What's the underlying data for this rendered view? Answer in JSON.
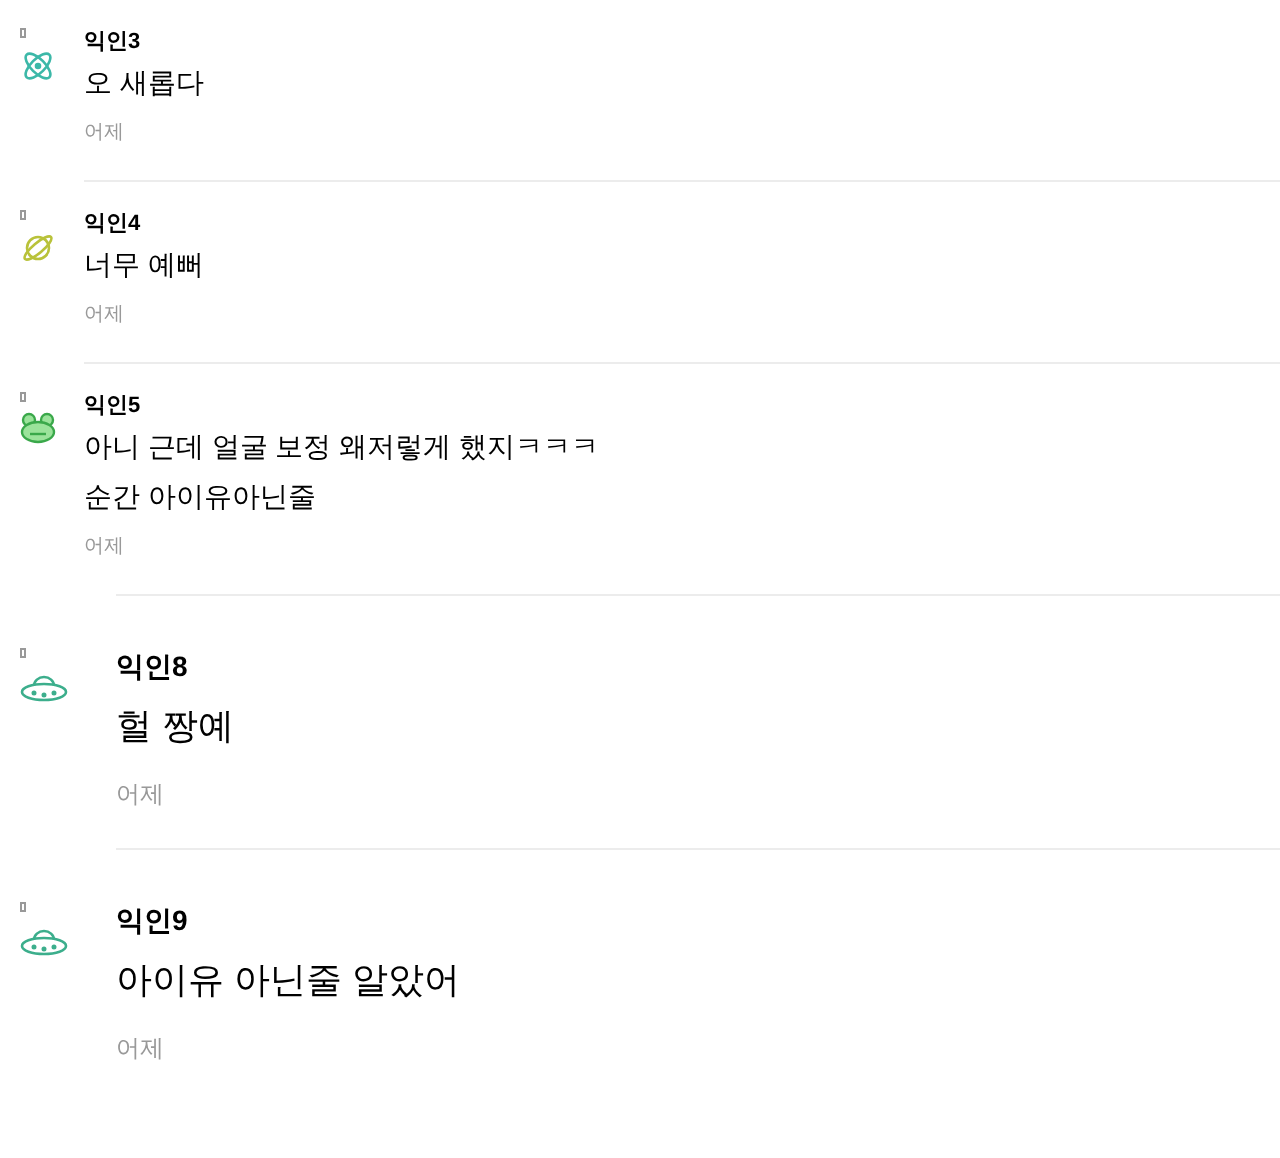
{
  "comments": [
    {
      "kind": "small",
      "avatar": {
        "kind": "atom"
      },
      "author": "익인3",
      "lines": [
        "오 새롭다"
      ],
      "time": "어제"
    },
    {
      "kind": "small",
      "avatar": {
        "kind": "planet"
      },
      "author": "익인4",
      "lines": [
        "너무 예뻐"
      ],
      "time": "어제"
    },
    {
      "kind": "small",
      "avatar": {
        "kind": "frog"
      },
      "author": "익인5",
      "lines": [
        "아니 근데 얼굴 보정 왜저렇게 했지ㅋㅋㅋ",
        "순간 아이유아닌줄"
      ],
      "time": "어제"
    },
    {
      "kind": "large",
      "avatar": {
        "kind": "ufo"
      },
      "author": "익인8",
      "lines": [
        "헐 짱예"
      ],
      "time": "어제"
    },
    {
      "kind": "large",
      "avatar": {
        "kind": "ufo"
      },
      "author": "익인9",
      "lines": [
        "아이유 아닌줄 알았어"
      ],
      "time": "어제"
    }
  ]
}
